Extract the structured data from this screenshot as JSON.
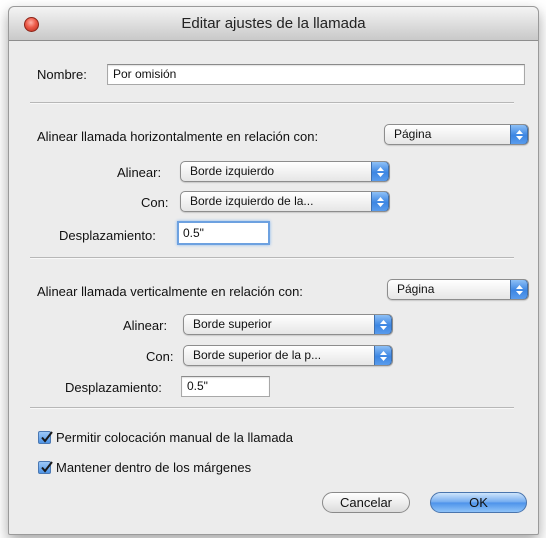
{
  "window": {
    "title": "Editar ajustes de la llamada"
  },
  "name_field": {
    "label": "Nombre:",
    "value": "Por omisión"
  },
  "horizontal": {
    "heading": "Alinear llamada horizontalmente en relación con:",
    "relative_to": "Página",
    "align_label": "Alinear:",
    "align_value": "Borde izquierdo",
    "with_label": "Con:",
    "with_value": "Borde izquierdo de la...",
    "offset_label": "Desplazamiento:",
    "offset_value": "0.5\""
  },
  "vertical": {
    "heading": "Alinear llamada verticalmente en relación con:",
    "relative_to": "Página",
    "align_label": "Alinear:",
    "align_value": "Borde superior",
    "with_label": "Con:",
    "with_value": "Borde superior de la p...",
    "offset_label": "Desplazamiento:",
    "offset_value": "0.5\""
  },
  "options": {
    "manual_placement": {
      "label": "Permitir colocación manual de la llamada",
      "checked": true
    },
    "keep_in_margins": {
      "label": "Mantener dentro de los márgenes",
      "checked": true
    }
  },
  "buttons": {
    "cancel": "Cancelar",
    "ok": "OK"
  },
  "colors": {
    "accent": "#4c92ea",
    "close_button": "#ec5a48",
    "window_bg": "#ececec"
  },
  "icons": {
    "close": "close-icon",
    "popup_arrows": "up-down-arrows-icon",
    "checkmark": "checkmark-icon"
  }
}
